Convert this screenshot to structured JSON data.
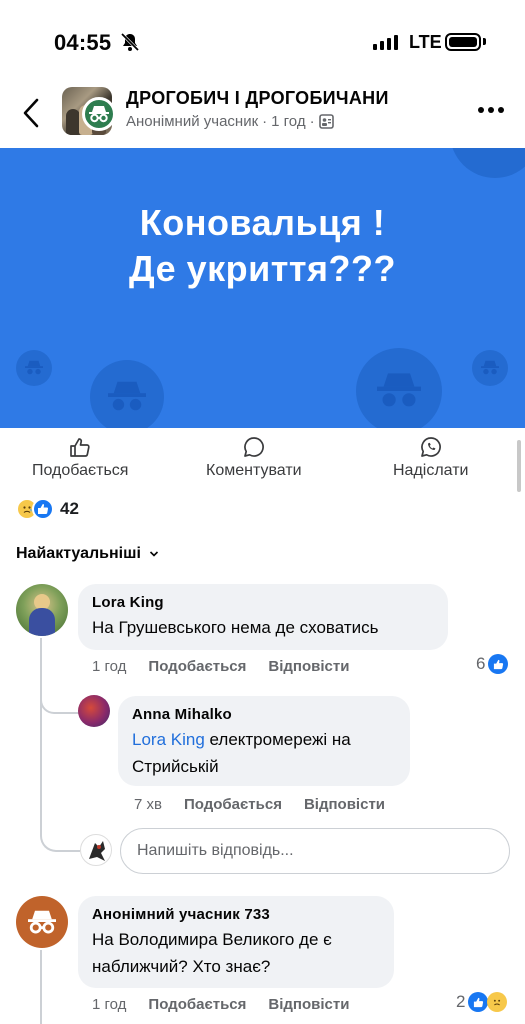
{
  "status_bar": {
    "time": "04:55",
    "network": "LTE"
  },
  "header": {
    "group_name": "ДРОГОБИЧ І ДРОГОБИЧАНИ",
    "author": "Анонімний учасник",
    "time": "1 год",
    "separator": "·"
  },
  "post": {
    "line1": "Коновальця !",
    "line2": "Де укриття???",
    "banner_color": "#2f7ae6"
  },
  "actions": {
    "like": "Подобається",
    "comment": "Коментувати",
    "send": "Надіслати"
  },
  "reactions": {
    "count": "42"
  },
  "sort": {
    "label": "Найактуальніші"
  },
  "comments": [
    {
      "author": "Lora King",
      "text": "На Грушевського нема де сховатись",
      "time": "1 год",
      "like": "Подобається",
      "reply": "Відповісти",
      "likes": "6",
      "replies": [
        {
          "author": "Anna  Mihalko",
          "mention": "Lora King",
          "text": " електромережі на Стрийській",
          "time": "7 хв",
          "like": "Подобається",
          "reply": "Відповісти"
        }
      ]
    },
    {
      "author": "Анонімний учасник 733",
      "text": "На Володимира Великого де є наближчий? Хто знає?",
      "time": "1 год",
      "like": "Подобається",
      "reply": "Відповісти",
      "likes": "2"
    }
  ],
  "reply_input": {
    "placeholder": "Напишіть відповідь..."
  },
  "colors": {
    "accent": "#216fdb",
    "muted": "#65676b",
    "bubble": "#f0f2f5"
  }
}
